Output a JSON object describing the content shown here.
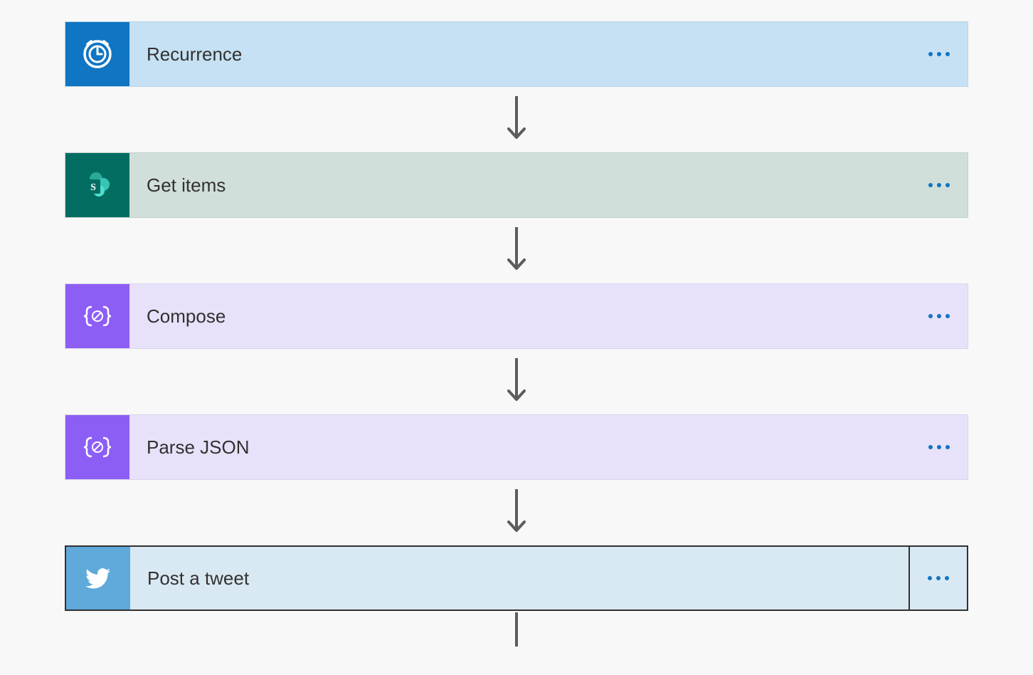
{
  "flow": {
    "steps": [
      {
        "id": "recurrence",
        "label": "Recurrence",
        "icon": "clock-icon",
        "type": "schedule"
      },
      {
        "id": "get-items",
        "label": "Get items",
        "icon": "sharepoint-icon",
        "type": "sharepoint"
      },
      {
        "id": "compose",
        "label": "Compose",
        "icon": "data-operation-icon",
        "type": "data-operation"
      },
      {
        "id": "parse-json",
        "label": "Parse JSON",
        "icon": "data-operation-icon",
        "type": "data-operation"
      },
      {
        "id": "post-tweet",
        "label": "Post a tweet",
        "icon": "twitter-icon",
        "type": "twitter"
      }
    ]
  },
  "colors": {
    "schedule_bg": "#c5e1f3",
    "schedule_icon": "#1075c2",
    "sharepoint_bg": "#d0dfd9",
    "sharepoint_icon": "#036d62",
    "dataop_bg": "#e7e1f9",
    "dataop_icon": "#8d5ef5",
    "twitter_bg": "#d9e9f3",
    "twitter_icon": "#5fa9db",
    "menu_dot": "#1075c2"
  }
}
